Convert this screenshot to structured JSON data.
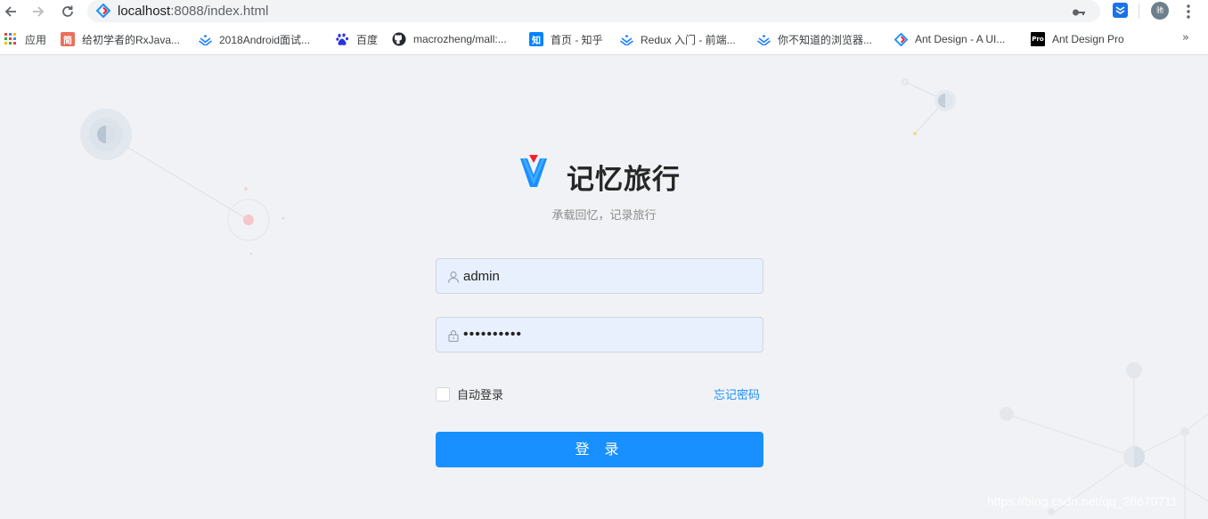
{
  "browser": {
    "url_host": "localhost",
    "url_rest": ":8088/index.html",
    "profile_initial": "驰"
  },
  "bookmarks": [
    {
      "label": "应用",
      "icon": "apps-grid-icon"
    },
    {
      "label": "给初学者的RxJava...",
      "icon": "jianshu-icon",
      "icon_text": "简"
    },
    {
      "label": "2018Android面试...",
      "icon": "juejin-icon"
    },
    {
      "label": "百度",
      "icon": "baidu-paw-icon"
    },
    {
      "label": "macrozheng/mall:...",
      "icon": "github-icon"
    },
    {
      "label": "首页 - 知乎",
      "icon": "zhihu-icon",
      "icon_text": "知"
    },
    {
      "label": "Redux 入门 - 前端...",
      "icon": "juejin-icon"
    },
    {
      "label": "你不知道的浏览器...",
      "icon": "juejin-icon"
    },
    {
      "label": "Ant Design - A UI...",
      "icon": "antd-icon"
    },
    {
      "label": "Ant Design Pro",
      "icon": "antd-pro-icon",
      "icon_text": "Pro"
    }
  ],
  "bookmarks_more": "»",
  "login": {
    "title": "记忆旅行",
    "subtitle": "承载回忆，记录旅行",
    "username_value": "admin",
    "password_value": "••••••••••",
    "remember_label": "自动登录",
    "forgot_label": "忘记密码",
    "submit_label": "登 录"
  },
  "watermark": "https://blog.csdn.net/qq_28670711",
  "colors": {
    "primary": "#1890ff",
    "page_bg": "#f0f2f5",
    "input_bg": "#e8f0fe"
  }
}
